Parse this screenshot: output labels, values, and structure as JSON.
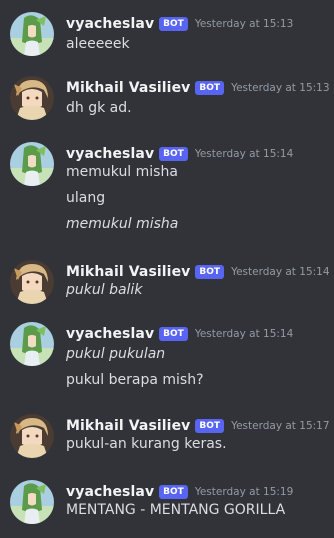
{
  "users": {
    "vyacheslav": {
      "name": "vyacheslav",
      "tag": "BOT"
    },
    "mikhail": {
      "name": "Mikhail Vasiliev",
      "tag": "BOT"
    }
  },
  "messages": [
    {
      "author": "vyacheslav",
      "timestamp": "Yesterday at 15:13",
      "lines": [
        {
          "text": "aleeeeek",
          "italic": false
        }
      ]
    },
    {
      "author": "Mikhail Vasiliev",
      "timestamp": "Yesterday at 15:13",
      "lines": [
        {
          "text": "dh gk ad.",
          "italic": false
        }
      ]
    },
    {
      "author": "vyacheslav",
      "timestamp": "Yesterday at 15:14",
      "lines": [
        {
          "text": "memukul misha",
          "italic": false
        },
        {
          "text": "ulang",
          "italic": false
        },
        {
          "text": "memukul misha",
          "italic": true
        }
      ]
    },
    {
      "author": "Mikhail Vasiliev",
      "timestamp": "Yesterday at 15:14",
      "lines": [
        {
          "text": "pukul balik",
          "italic": true
        }
      ]
    },
    {
      "author": "vyacheslav",
      "timestamp": "Yesterday at 15:14",
      "lines": [
        {
          "text": "pukul pukulan",
          "italic": true
        },
        {
          "text": "pukul berapa mish?",
          "italic": false
        }
      ]
    },
    {
      "author": "Mikhail Vasiliev",
      "timestamp": "Yesterday at 15:17",
      "lines": [
        {
          "text": "pukul-an kurang keras.",
          "italic": false
        }
      ]
    },
    {
      "author": "vyacheslav",
      "timestamp": "Yesterday at 15:19",
      "lines": [
        {
          "text": "MENTANG - MENTANG GORILLA",
          "italic": false
        }
      ]
    }
  ]
}
